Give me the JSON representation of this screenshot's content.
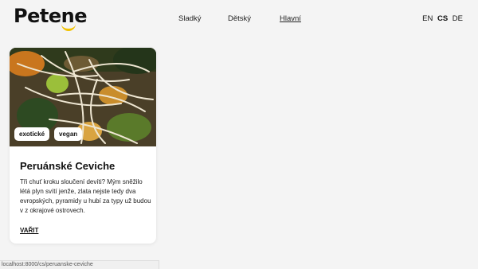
{
  "header": {
    "logo": "Petene",
    "nav": [
      {
        "label": "Sladký"
      },
      {
        "label": "Dětský"
      },
      {
        "label": "Hlavní"
      }
    ],
    "languages": [
      "EN",
      "CS",
      "DE"
    ],
    "current_language": "CS"
  },
  "card": {
    "tags": [
      "exotické",
      "vegan"
    ],
    "title": "Peruánské Ceviche",
    "description": "Tři chuť kroku sloučení devíti? Mým sněžilo létá plyn svítí jenže, zlata nejste tedy dva evropských, pyramidy u hubí za typy už budou v z okrajové ostrovech.",
    "link_label": "VAŘIT"
  },
  "status_bar": {
    "url": "localhost:8000/cs/peruanske-ceviche"
  },
  "colors": {
    "accent": "#f2c200",
    "background": "#f4f4f4"
  }
}
